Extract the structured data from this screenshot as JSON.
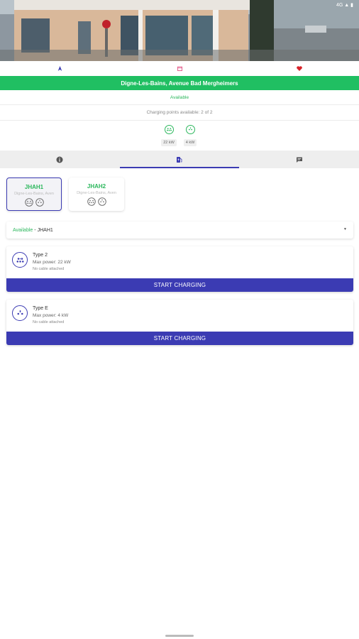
{
  "status_bar": {
    "time": "",
    "icons": "4G ▲ ▮"
  },
  "actions": {
    "navigate_icon": "navigation-arrow-icon",
    "calendar_icon": "calendar-icon",
    "favorite_icon": "heart-icon",
    "colors": {
      "navigate": "#3b3bb3",
      "calendar": "#e0457b",
      "favorite": "#d8232a"
    }
  },
  "station": {
    "title": "Digne-Les-Bains, Avenue Bad Mergheimers",
    "status": "Available",
    "charging_points_text": "Charging points available: 2 of 2",
    "connector_powers": [
      "22 kW",
      "4 kW"
    ]
  },
  "tabs": [
    {
      "name": "info",
      "icon": "info-icon"
    },
    {
      "name": "charging",
      "icon": "charging-station-icon",
      "active": true
    },
    {
      "name": "comments",
      "icon": "chat-icon"
    }
  ],
  "charge_points": [
    {
      "name": "JHAH1",
      "address": "Digne-Les-Bains, Aven",
      "selected": true
    },
    {
      "name": "JHAH2",
      "address": "Digne-Les-Bains, Aven",
      "selected": false
    }
  ],
  "selector": {
    "status": "Available",
    "separator": "-",
    "value": "JHAH1"
  },
  "connectors": [
    {
      "type": "Type 2",
      "power": "Max power: 22 kW",
      "cable": "No cable attached",
      "button": "START CHARGING"
    },
    {
      "type": "Type E",
      "power": "Max power: 4 kW",
      "cable": "No cable attached",
      "button": "START CHARGING"
    }
  ],
  "colors": {
    "accent": "#3b3bb3",
    "available": "#20bf62"
  }
}
